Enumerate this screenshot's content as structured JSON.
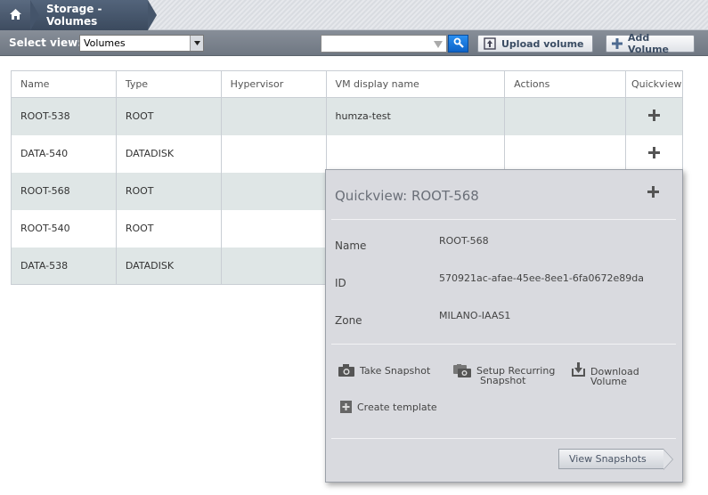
{
  "breadcrumb": {
    "home_icon": "home-icon",
    "current": "Storage - Volumes"
  },
  "toolbar": {
    "select_view_label": "Select view:",
    "select_view_value": "Volumes",
    "search_value": "",
    "upload_volume_label": "Upload volume",
    "add_volume_label": "Add Volume"
  },
  "grid": {
    "columns": [
      "Name",
      "Type",
      "Hypervisor",
      "VM display name",
      "Actions",
      "Quickview"
    ],
    "rows": [
      {
        "name": "ROOT-538",
        "type": "ROOT",
        "hypervisor": "",
        "vm": "humza-test",
        "actions": ""
      },
      {
        "name": "DATA-540",
        "type": "DATADISK",
        "hypervisor": "",
        "vm": "",
        "actions": ""
      },
      {
        "name": "ROOT-568",
        "type": "ROOT",
        "hypervisor": "",
        "vm": "",
        "actions": ""
      },
      {
        "name": "ROOT-540",
        "type": "ROOT",
        "hypervisor": "",
        "vm": "",
        "actions": ""
      },
      {
        "name": "DATA-538",
        "type": "DATADISK",
        "hypervisor": "",
        "vm": "",
        "actions": ""
      }
    ]
  },
  "quickview": {
    "title": "Quickview: ROOT-568",
    "fields": [
      {
        "key": "Name",
        "value": "ROOT-568"
      },
      {
        "key": "ID",
        "value": "570921ac-afae-45ee-8ee1-6fa0672e89da"
      },
      {
        "key": "Zone",
        "value": "MILANO-IAAS1"
      }
    ],
    "actions": {
      "take_snapshot": "Take Snapshot",
      "setup_recurring_1": "Setup Recurring",
      "setup_recurring_2": "Snapshot",
      "download_1": "Download",
      "download_2": "Volume",
      "create_template": "Create template"
    },
    "view_snapshots": "View Snapshots"
  },
  "colors": {
    "accent_blue": "#0d63c8",
    "row_alt": "#dfe6e6",
    "breadcrumb": "#46566b"
  }
}
